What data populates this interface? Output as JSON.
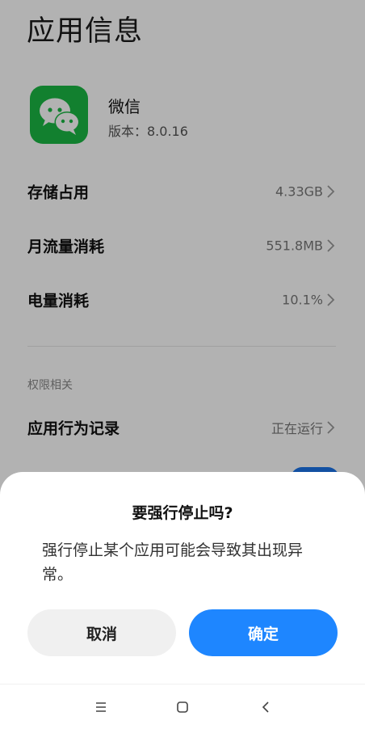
{
  "page": {
    "title": "应用信息"
  },
  "app": {
    "name": "微信",
    "version": "版本：8.0.16",
    "icon": "wechat-icon",
    "icon_color": "#1bb844"
  },
  "settings_rows": [
    {
      "label": "存储占用",
      "value": "4.33GB"
    },
    {
      "label": "月流量消耗",
      "value": "551.8MB"
    },
    {
      "label": "电量消耗",
      "value": "10.1%"
    }
  ],
  "permissions_section": {
    "header": "权限相关",
    "rows": [
      {
        "label": "应用行为记录",
        "value": "正在运行"
      }
    ]
  },
  "dialog": {
    "title": "要强行停止吗?",
    "message": "强行停止某个应用可能会导致其出现异常。",
    "cancel_label": "取消",
    "confirm_label": "确定",
    "confirm_color": "#1e86ff"
  },
  "nav": {
    "items": [
      "menu-icon",
      "home-icon",
      "back-icon"
    ]
  }
}
